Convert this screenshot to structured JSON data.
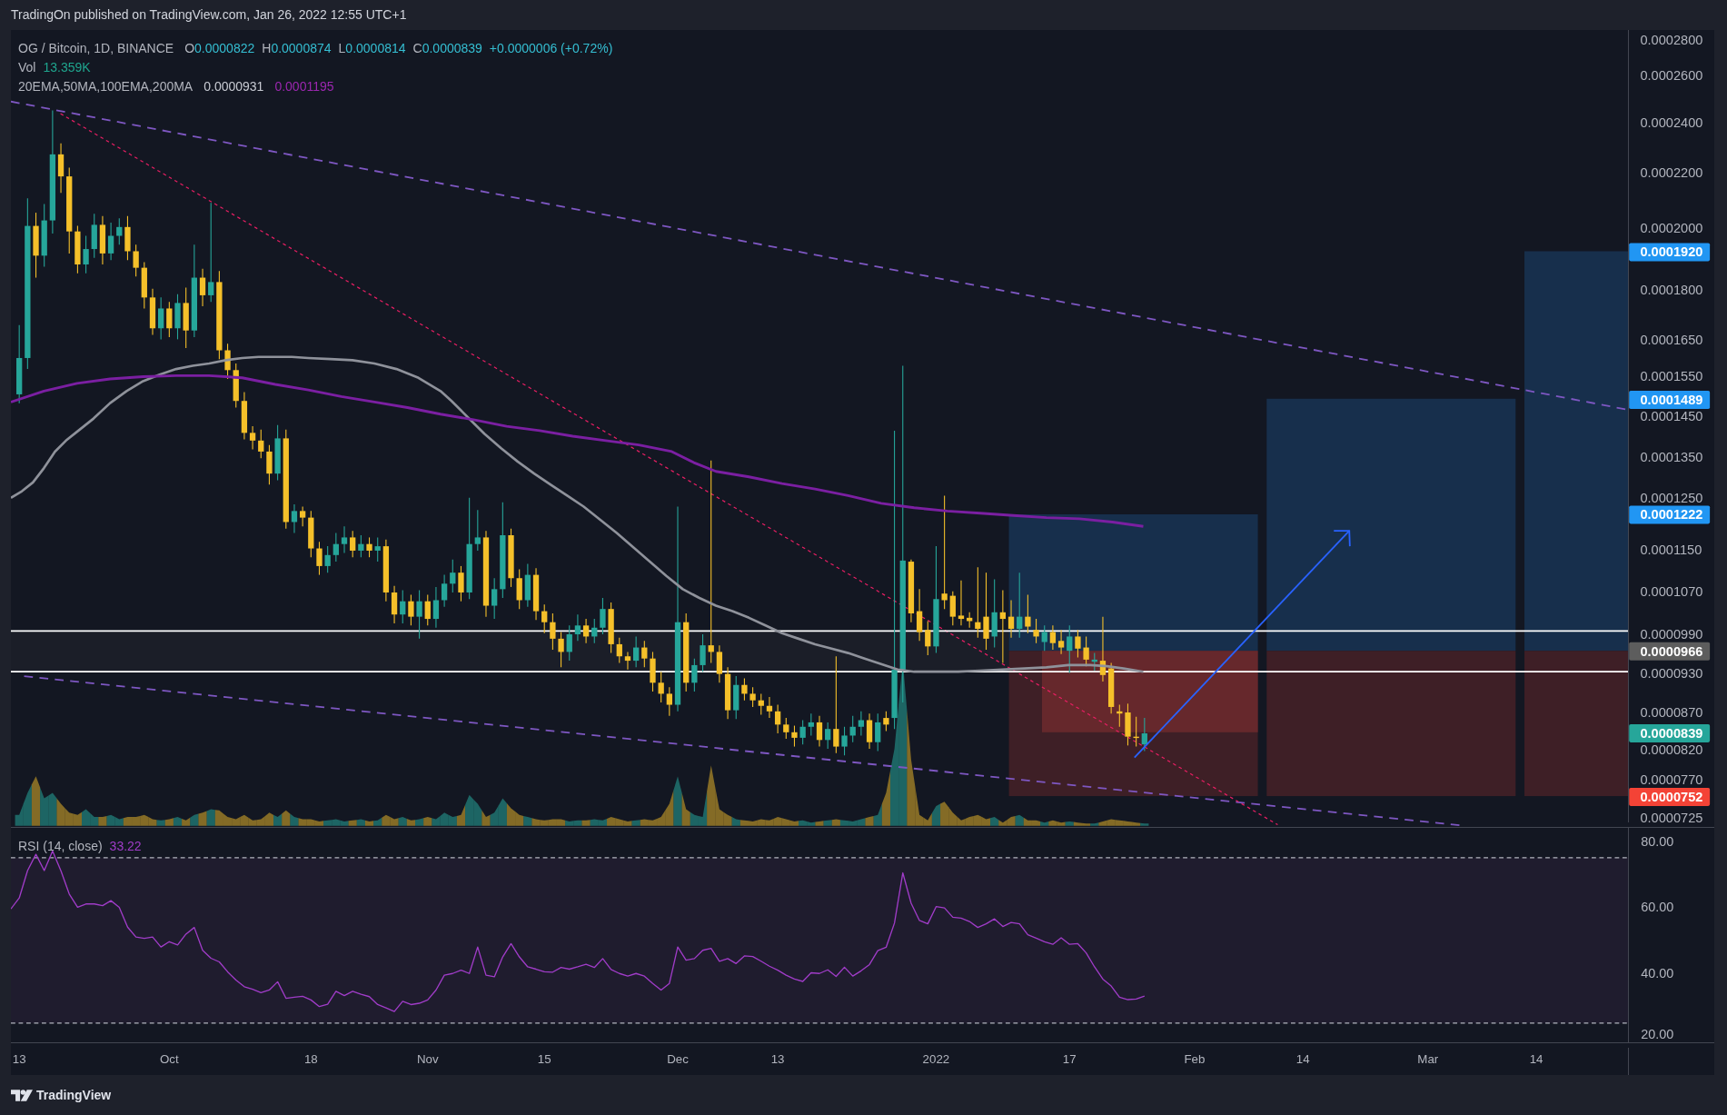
{
  "attribution": "TradingOn published on TradingView.com, Jan 26, 2022 12:55 UTC+1",
  "legend": {
    "symbol": "OG / Bitcoin, 1D, BINANCE",
    "ohlc": [
      {
        "label": "O",
        "value": "0.0000822"
      },
      {
        "label": "H",
        "value": "0.0000874"
      },
      {
        "label": "L",
        "value": "0.0000814"
      },
      {
        "label": "C",
        "value": "0.0000839"
      }
    ],
    "change": "+0.0000006 (+0.72%)"
  },
  "volume": {
    "label": "Vol",
    "value": "13.359K"
  },
  "indicators": {
    "label": "20EMA,50MA,100EMA,200MA",
    "values": [
      {
        "value": "0.0000931",
        "color": "#c8cbd3"
      },
      {
        "value": "0.0001195",
        "color": "#9c27b0"
      }
    ]
  },
  "price_axis": {
    "ticks": [
      "0.0002800",
      "0.0002600",
      "0.0002400",
      "0.0002200",
      "0.0002000",
      "0.0001800",
      "0.0001650",
      "0.0001550",
      "0.0001450",
      "0.0001350",
      "0.0001250",
      "0.0001150",
      "0.0001070",
      "0.0000990",
      "0.0000930",
      "0.0000870",
      "0.0000820",
      "0.0000770",
      "0.0000725"
    ],
    "price_labels": [
      {
        "value": "0.0001920",
        "color": "#2196f3"
      },
      {
        "value": "0.0001489",
        "color": "#2196f3"
      },
      {
        "value": "0.0001222",
        "color": "#2196f3"
      },
      {
        "value": "0.0000966",
        "color": "#5d5d5d"
      },
      {
        "value": "0.0000839",
        "color": "#26a69a"
      },
      {
        "value": "0.0000752",
        "color": "#f44336"
      }
    ]
  },
  "rsi": {
    "value": "33.22",
    "chart_data": {
      "type": "line",
      "categories": [
        null,
        "13",
        null,
        null,
        null,
        null,
        null,
        null,
        null,
        null,
        null,
        null,
        null,
        null,
        null,
        null,
        null,
        null,
        null,
        "Oct",
        null,
        null,
        null,
        null,
        null,
        null,
        null,
        null,
        null,
        null,
        null,
        null,
        null,
        null,
        null,
        null,
        "18",
        null,
        null,
        null,
        null,
        null,
        null,
        null,
        null,
        null,
        null,
        null,
        null,
        null,
        "Nov",
        null,
        null,
        null,
        null,
        null,
        null,
        null,
        null,
        null,
        null,
        null,
        null,
        null,
        "15",
        null,
        null,
        null,
        null,
        null,
        null,
        null,
        null,
        null,
        null,
        null,
        null,
        null,
        null,
        null,
        "Dec",
        null,
        null,
        null,
        null,
        null,
        null,
        null,
        null,
        null,
        null,
        null,
        "13",
        null,
        null,
        null,
        null,
        null,
        null,
        null,
        null,
        null,
        null,
        null,
        null,
        null,
        null,
        null,
        null,
        null,
        null,
        "2022",
        null,
        null,
        null,
        null,
        null,
        null,
        null,
        null,
        null,
        null,
        null,
        null,
        null,
        null,
        null,
        "17",
        null,
        null,
        null,
        null,
        null,
        null,
        null,
        null,
        null,
        null,
        null,
        null,
        null,
        null,
        "Feb",
        null,
        null,
        null,
        null,
        null,
        null,
        null,
        null,
        null,
        null,
        null,
        null,
        "14",
        null,
        null,
        null,
        null,
        null,
        null,
        null,
        null,
        null,
        null,
        null,
        null,
        null,
        null,
        "Mar",
        null,
        null,
        null,
        null,
        null,
        null,
        null,
        null,
        null,
        null,
        null,
        null,
        "14",
        null,
        null,
        null,
        null,
        null,
        null,
        null,
        null,
        null,
        null
      ],
      "series": [
        {
          "name": "RSI (14, close)",
          "color": "#a03cc8",
          "values": [
            59.5,
            62.8,
            71.1,
            76.0,
            71.1,
            77.0,
            71.0,
            64.0,
            60.0,
            61.0,
            61.0,
            60.5,
            62.0,
            60.0,
            54.0,
            51.0,
            50.6,
            51.0,
            48.0,
            49.6,
            48.6,
            51.9,
            53.9,
            47.0,
            44.6,
            43.5,
            40.5,
            38.0,
            36.0,
            35.2,
            34.2,
            35.0,
            37.5,
            32.5,
            32.8,
            33.1,
            32.0,
            30.0,
            30.7,
            34.6,
            33.3,
            34.6,
            33.7,
            33.0,
            30.6,
            29.6,
            28.5,
            31.6,
            30.6,
            31.0,
            32.0,
            35.0,
            39.5,
            40.0,
            41.0,
            40.0,
            48.0,
            39.5,
            39.0,
            45.0,
            49.0,
            45.0,
            42.0,
            41.3,
            40.5,
            40.4,
            41.8,
            41.3,
            42.0,
            42.8,
            41.8,
            44.5,
            41.2,
            40.0,
            39.2,
            40.0,
            39.2,
            37.0,
            35.0,
            37.0,
            48.0,
            44.0,
            44.5,
            47.0,
            47.6,
            43.7,
            44.5,
            43.0,
            45.3,
            45.1,
            43.7,
            42.2,
            41.0,
            39.5,
            38.3,
            37.6,
            40.2,
            40.0,
            41.1,
            39.1,
            41.9,
            39.2,
            40.8,
            42.7,
            46.9,
            47.9,
            55.2,
            70.4,
            61.2,
            56.0,
            55.0,
            60.2,
            59.8,
            57.0,
            56.7,
            55.7,
            53.9,
            55.0,
            56.5,
            54.2,
            55.4,
            55.0,
            51.7,
            50.7,
            49.6,
            48.8,
            50.8,
            48.8,
            49.0,
            46.2,
            42.0,
            38.3,
            36.2,
            32.8,
            32.1,
            32.3,
            33.2,
            null,
            null,
            null,
            null,
            null,
            null,
            null,
            null,
            null,
            null,
            null,
            null,
            null,
            null,
            null,
            null,
            null,
            null,
            null,
            null,
            null,
            null,
            null,
            null,
            null,
            null,
            null,
            null,
            null,
            null,
            null,
            null,
            null,
            null,
            null,
            null,
            null,
            null,
            null,
            null,
            null,
            null,
            null,
            null,
            null,
            null,
            null,
            null,
            null,
            null,
            null,
            null,
            null,
            null,
            null,
            null,
            null
          ]
        }
      ],
      "ylim": [
        19.2,
        84.0
      ],
      "yticks": [
        {
          "value": 80,
          "label": "80.00"
        },
        {
          "value": 60,
          "label": "60.00"
        },
        {
          "value": 40,
          "label": "40.00"
        },
        {
          "value": 20,
          "label": "20.00"
        }
      ],
      "bands": [
        {
          "axis": "y",
          "from": 25,
          "to": 75
        }
      ],
      "ref_lines": [
        {
          "axis": "y",
          "value": 75
        },
        {
          "axis": "y",
          "value": 25
        }
      ]
    }
  },
  "footer": {
    "brand": "TradingView"
  }
}
